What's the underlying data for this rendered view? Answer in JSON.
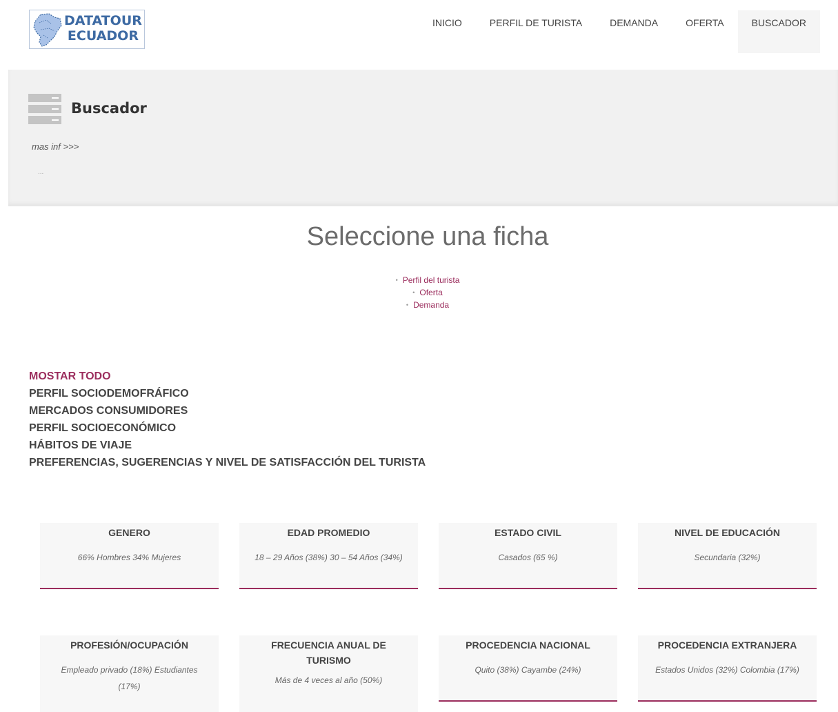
{
  "brand": {
    "line1": "DATATOUR",
    "line2": "ECUADOR"
  },
  "nav": {
    "items": [
      {
        "label": "INICIO"
      },
      {
        "label": "PERFIL DE TURISTA"
      },
      {
        "label": "DEMANDA"
      },
      {
        "label": "OFERTA"
      },
      {
        "label": "BUSCADOR"
      }
    ],
    "active": "BUSCADOR"
  },
  "panel": {
    "title": "Buscador",
    "more": "mas inf >>>",
    "dots": "..."
  },
  "selector": {
    "heading": "Seleccione una ficha",
    "options": [
      "Perfil del turista",
      "Oferta",
      "Demanda"
    ]
  },
  "filters": [
    "MOSTAR TODO",
    "PERFIL SOCIODEMOFRÁFICO",
    "MERCADOS CONSUMIDORES",
    "PERFIL SOCIOECONÓMICO",
    "HÁBITOS DE VIAJE",
    "PREFERENCIAS, SUGERENCIAS Y NIVEL DE SATISFACCIÓN DEL TURISTA"
  ],
  "cards": [
    {
      "title": "GENERO",
      "value": "66% Hombres 34% Mujeres"
    },
    {
      "title": "EDAD PROMEDIO",
      "value": "18 – 29 Años (38%) 30 – 54 Años (34%)"
    },
    {
      "title": "ESTADO CIVIL",
      "value": "Casados (65 %)"
    },
    {
      "title": "NIVEL DE EDUCACIÓN",
      "value": "Secundaria (32%)"
    },
    {
      "title": "PROFESIÓN/OCUPACIÓN",
      "value": "Empleado privado (18%) Estudiantes (17%)"
    },
    {
      "title": "FRECUENCIA ANUAL DE TURISMO",
      "value": "Más de 4 veces al año (50%)"
    },
    {
      "title": "PROCEDENCIA NACIONAL",
      "value": "Quito (38%) Cayambe (24%)"
    },
    {
      "title": "PROCEDENCIA EXTRANJERA",
      "value": "Estados Unidos (32%) Colombia (17%)"
    }
  ],
  "colors": {
    "accent": "#9b2d5d",
    "brand": "#3d6aa3",
    "panel": "#f1f1f1"
  }
}
